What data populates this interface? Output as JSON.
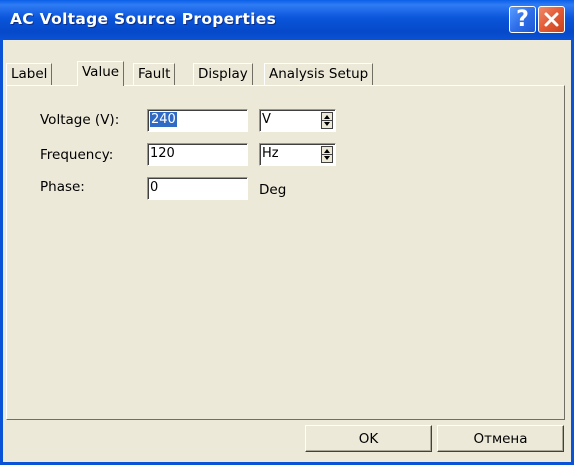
{
  "window": {
    "title": "AC Voltage Source Properties",
    "help_label": "?"
  },
  "tabs": [
    {
      "label": "Label"
    },
    {
      "label": "Value",
      "active": true
    },
    {
      "label": "Fault"
    },
    {
      "label": "Display"
    },
    {
      "label": "Analysis Setup"
    }
  ],
  "form": {
    "voltage": {
      "label": "Voltage (V):",
      "value": "240",
      "unit": "V"
    },
    "frequency": {
      "label": "Frequency:",
      "value": "120",
      "unit": "Hz"
    },
    "phase": {
      "label": "Phase:",
      "value": "0",
      "unit": "Deg"
    }
  },
  "buttons": {
    "ok": "OK",
    "cancel": "Отмена"
  },
  "icons": {
    "help": "help-icon",
    "close": "close-icon",
    "spin": "spin-updown-icon"
  }
}
